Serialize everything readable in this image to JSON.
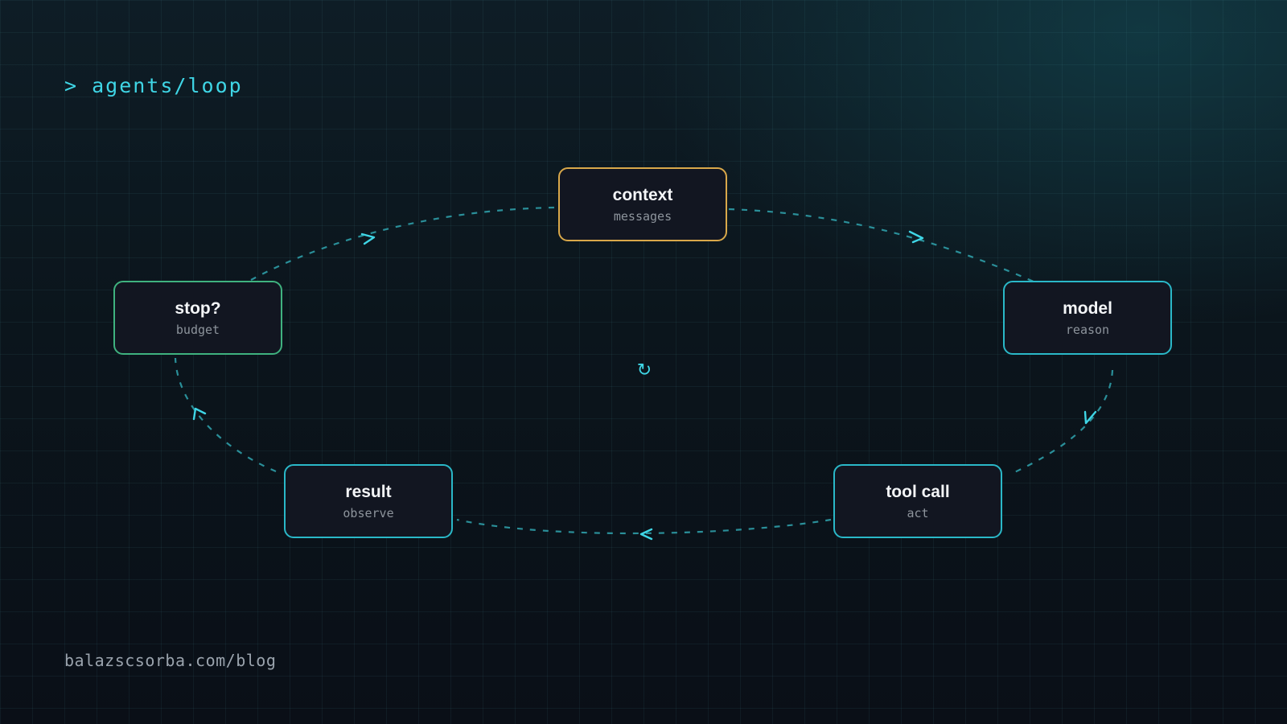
{
  "header": {
    "title": "> agents/loop"
  },
  "footer": {
    "url": "balazscsorba.com/blog"
  },
  "colors": {
    "accent": "#3fd6e6",
    "node_border": "#2ab8c8",
    "context_border": "#d9a84a",
    "stop_border": "#3fb27f",
    "edge": "#2a8f99",
    "node_fill": "#121621"
  },
  "center_icon": {
    "name": "loop-icon",
    "glyph": "↻"
  },
  "nodes": {
    "context": {
      "title": "context",
      "subtitle": "messages"
    },
    "model": {
      "title": "model",
      "subtitle": "reason"
    },
    "tool_call": {
      "title": "tool call",
      "subtitle": "act"
    },
    "result": {
      "title": "result",
      "subtitle": "observe"
    },
    "stop": {
      "title": "stop?",
      "subtitle": "budget"
    }
  },
  "edges": [
    {
      "from": "context",
      "to": "model"
    },
    {
      "from": "model",
      "to": "tool_call"
    },
    {
      "from": "tool_call",
      "to": "result"
    },
    {
      "from": "result",
      "to": "stop"
    },
    {
      "from": "stop",
      "to": "context"
    }
  ]
}
